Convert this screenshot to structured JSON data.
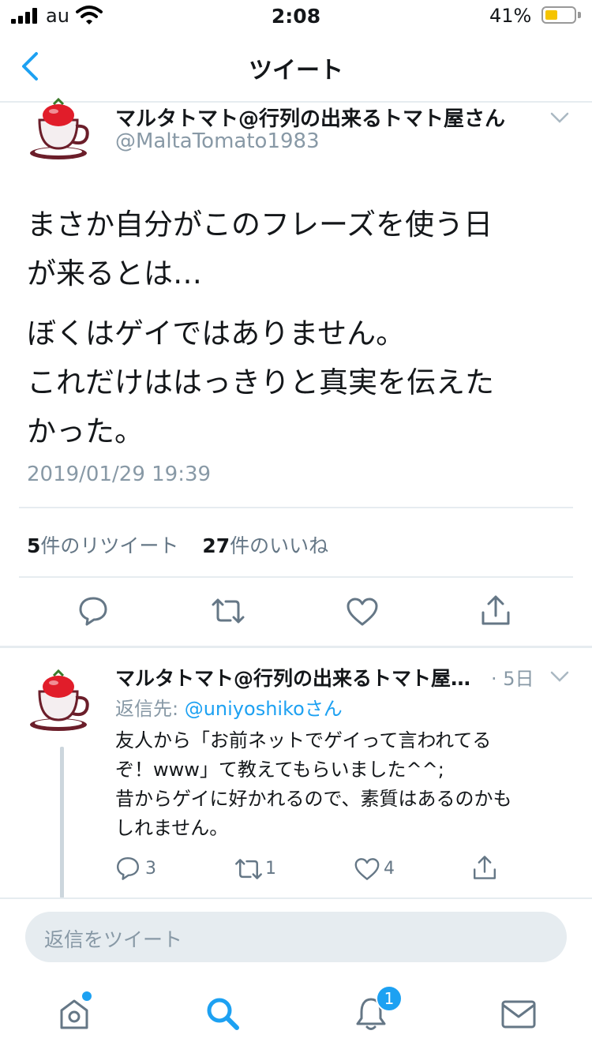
{
  "status_bar": {
    "carrier": "au",
    "time": "2:08",
    "battery": "41%",
    "battery_level": 0.41
  },
  "nav": {
    "title": "ツイート",
    "back_icon": "chevron-left-icon"
  },
  "tweet": {
    "author_name": "マルタトマト@行列の出来るトマト屋さん",
    "handle": "@MaltaTomato1983",
    "lines": [
      "まさか自分がこのフレーズを使う日",
      "が来るとは…",
      "ぼくはゲイではありません。",
      "これだけははっきりと真実を伝えた",
      "かった。"
    ],
    "timestamp": "2019/01/29 19:39",
    "retweet_count": "5",
    "retweet_label": "件のリツイート",
    "like_count": "27",
    "like_label": "件のいいね"
  },
  "reply": {
    "author_name": "マルタトマト@行列の出来るトマト屋…",
    "age": "· 5日",
    "reply_to_label": "返信先: ",
    "reply_to_user": "@uniyoshiko",
    "reply_to_suffix": "さん",
    "lines": [
      "友人から「お前ネットでゲイって言われてる",
      "ぞ！www」て教えてもらいました^^;",
      "昔からゲイに好かれるので、素質はあるのかも",
      "しれません。"
    ],
    "reply_count": "3",
    "retweet_count": "1",
    "like_count": "4"
  },
  "composer": {
    "placeholder": "返信をツイート"
  },
  "tabbar": {
    "notification_badge": "1"
  },
  "colors": {
    "accent": "#1da1f2",
    "muted": "#8899a6",
    "divider": "#e6ecf0"
  }
}
